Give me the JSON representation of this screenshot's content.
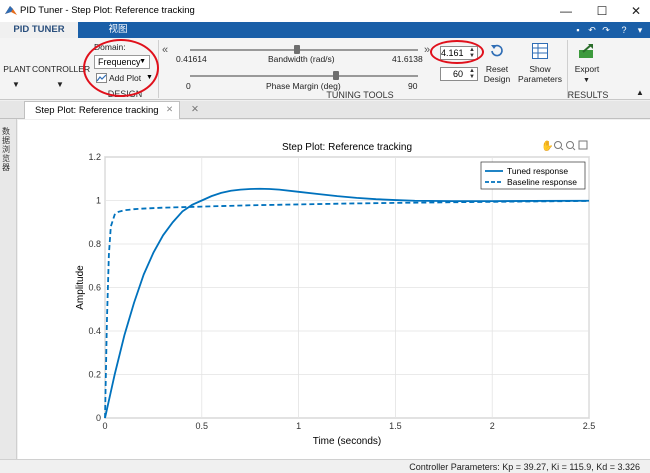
{
  "window": {
    "title": "PID Tuner - Step Plot: Reference tracking",
    "minimize_glyph": "—",
    "maximize_glyph": "☐",
    "close_glyph": "✕"
  },
  "tabs": [
    {
      "label": "PID TUNER"
    },
    {
      "label": "视图"
    }
  ],
  "ribbon": {
    "plant_label": "PLANT",
    "controller_label": "CONTROLLER",
    "domain_label": "Domain:",
    "domain_value": "Frequency",
    "add_plot_label": "Add Plot",
    "design_group": "DESIGN",
    "collapse_glyph": "«",
    "expand_glyph": "»",
    "bandwidth_min": "0.41614",
    "bandwidth_label": "Bandwidth (rad/s)",
    "bandwidth_max": "41.6138",
    "bandwidth_value": "4.161",
    "phase_min": "0",
    "phase_label": "Phase Margin (deg)",
    "phase_max": "90",
    "phase_value": "60",
    "tuning_group": "TUNING TOOLS",
    "reset_line1": "Reset",
    "reset_line2": "Design",
    "show_line1": "Show",
    "show_line2": "Parameters",
    "export_label": "Export",
    "results_group": "RESULTS"
  },
  "doc": {
    "tab_label": "Step Plot: Reference tracking",
    "side_label": "数据浏览器"
  },
  "status": {
    "text": "Controller Parameters: Kp = 39.27, Ki = 115.9, Kd = 3.326"
  },
  "chart_data": {
    "type": "line",
    "title": "Step Plot: Reference tracking",
    "xlabel": "Time (seconds)",
    "ylabel": "Amplitude",
    "xlim": [
      0,
      2.5
    ],
    "ylim": [
      0,
      1.2
    ],
    "xticks": [
      "0",
      "0.5",
      "1",
      "1.5",
      "2",
      "2.5"
    ],
    "yticks": [
      "0",
      "0.2",
      "0.4",
      "0.6",
      "0.8",
      "1",
      "1.2"
    ],
    "legend_position": "top-right",
    "series": [
      {
        "name": "Tuned response",
        "style": "solid",
        "color": "#0072bd",
        "x": [
          0,
          0.05,
          0.1,
          0.15,
          0.2,
          0.25,
          0.3,
          0.35,
          0.4,
          0.45,
          0.5,
          0.55,
          0.6,
          0.65,
          0.7,
          0.75,
          0.8,
          0.85,
          0.9,
          1.0,
          1.1,
          1.2,
          1.3,
          1.4,
          1.5,
          1.6,
          1.8,
          2.0,
          2.2,
          2.5
        ],
        "values": [
          0,
          0.2,
          0.38,
          0.53,
          0.66,
          0.76,
          0.84,
          0.9,
          0.95,
          0.98,
          1.0,
          1.02,
          1.035,
          1.045,
          1.05,
          1.053,
          1.054,
          1.053,
          1.05,
          1.04,
          1.03,
          1.02,
          1.012,
          1.006,
          1.002,
          0.999,
          0.997,
          0.997,
          0.998,
          0.999
        ]
      },
      {
        "name": "Baseline response",
        "style": "dashed",
        "color": "#0072bd",
        "x": [
          0,
          0.01,
          0.02,
          0.03,
          0.05,
          0.07,
          0.1,
          0.15,
          0.2,
          0.3,
          0.5,
          0.75,
          1.0,
          1.25,
          1.5,
          2.0,
          2.5
        ],
        "values": [
          0,
          0.45,
          0.75,
          0.88,
          0.935,
          0.948,
          0.955,
          0.96,
          0.963,
          0.967,
          0.972,
          0.978,
          0.982,
          0.986,
          0.989,
          0.994,
          0.998
        ]
      }
    ]
  }
}
